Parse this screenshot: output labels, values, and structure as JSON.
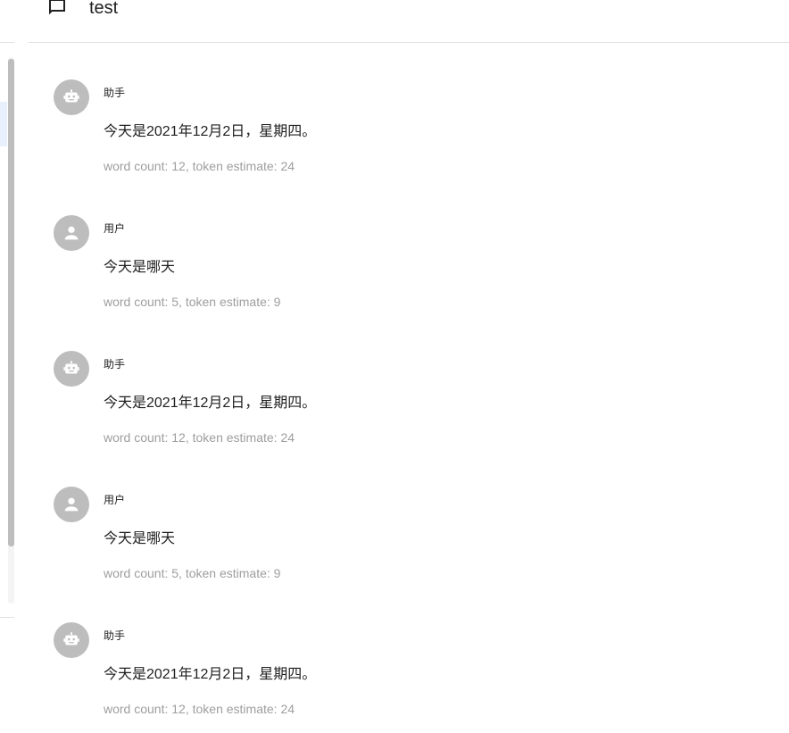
{
  "header": {
    "title": "test",
    "icon": "chat-bubble-icon"
  },
  "messages": [
    {
      "role": "助手",
      "avatar_icon": "robot-icon",
      "content": "今天是2021年12月2日，星期四。",
      "stats": "word count: 12, token estimate: 24"
    },
    {
      "role": "用户",
      "avatar_icon": "person-icon",
      "content": "今天是哪天",
      "stats": "word count: 5, token estimate: 9"
    },
    {
      "role": "助手",
      "avatar_icon": "robot-icon",
      "content": "今天是2021年12月2日，星期四。",
      "stats": "word count: 12, token estimate: 24"
    },
    {
      "role": "用户",
      "avatar_icon": "person-icon",
      "content": "今天是哪天",
      "stats": "word count: 5, token estimate: 9"
    },
    {
      "role": "助手",
      "avatar_icon": "robot-icon",
      "content": "今天是2021年12月2日，星期四。",
      "stats": "word count: 12, token estimate: 24"
    }
  ],
  "colors": {
    "avatar_bg": "#bdbdbd",
    "text_primary": "#212121",
    "text_secondary": "#9e9e9e",
    "divider": "#e0e0e0"
  }
}
